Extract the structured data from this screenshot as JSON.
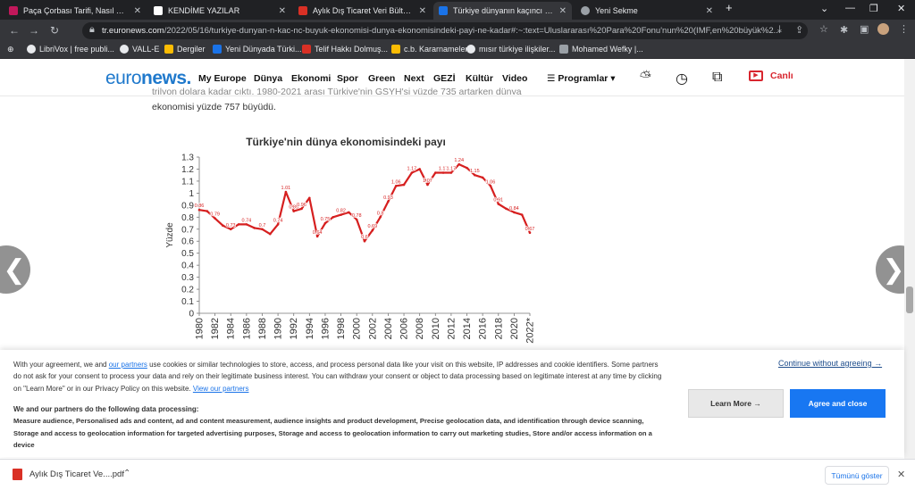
{
  "browser": {
    "tabs": [
      {
        "title": "Paça Çorbası Tarifi, Nasıl Yapılır?",
        "color": "#c2185b",
        "active": false
      },
      {
        "title": "KENDİME YAZILAR",
        "color": "#ffffff",
        "active": false
      },
      {
        "title": "Aylık Dış Ticaret Veri Bülteni_May",
        "color": "#d93025",
        "active": false
      },
      {
        "title": "Türkiye dünyanın kaçıncı büyük ekonomisi",
        "color": "#1a73e8",
        "active": true
      },
      {
        "title": "Yeni Sekme",
        "color": "#9aa0a6",
        "active": false
      }
    ],
    "new_tab": "+",
    "window_controls": {
      "chevron": "⌄",
      "minimize": "—",
      "maximize": "❐",
      "close": "✕"
    },
    "nav": {
      "back": "←",
      "forward": "→",
      "reload": "↻"
    },
    "url_host": "tr.euronews.com",
    "url_path": "/2022/05/16/turkiye-dunyan-n-kac-nc-buyuk-ekonomisi-dunya-ekonomisindeki-payi-ne-kadar#:~:text=Uluslararası%20Para%20Fonu'nun%20(IMF,en%20büyük%2..."
  },
  "bookmarks": [
    {
      "label": "LibriVox | free publi...",
      "color": "#e8eaed"
    },
    {
      "label": "VALL-E",
      "color": "#e8eaed"
    },
    {
      "label": "Dergiler",
      "color": "#fbbc04"
    },
    {
      "label": "Yeni Dünyada Türki...",
      "color": "#1a73e8"
    },
    {
      "label": "Telif Hakkı Dolmuş...",
      "color": "#d93025"
    },
    {
      "label": "c.b. Kararnameler",
      "color": "#fbbc04"
    },
    {
      "label": "mısır türkiye ilişkiler...",
      "color": "#e8eaed"
    },
    {
      "label": "Mohamed Wefky |...",
      "color": "#9aa0a6"
    }
  ],
  "site": {
    "logo_prefix": "euro",
    "logo_suffix": "news.",
    "nav_links": [
      "My Europe",
      "Dünya",
      "Ekonomi",
      "Spor",
      "Green",
      "Next",
      "GEZİ",
      "Kültür",
      "Video"
    ],
    "programs_label": "Programlar",
    "live_label": "Canlı",
    "accent_color": "#1f79cc",
    "live_color": "#d8262f"
  },
  "article": {
    "line1": "trilyon dolara kadar çıktı. 1980-2021 arası Türkiye'nin GSYH'si yüzde 735 artarken dünya",
    "line2": "ekonomisi yüzde 757 büyüdü."
  },
  "chart_data": {
    "type": "line",
    "title": "Türkiye'nin dünya ekonomisindeki payı",
    "ylabel": "Yüzde",
    "xlabel": "",
    "ylim": [
      0,
      1.3
    ],
    "yticks": [
      0,
      0.1,
      0.2,
      0.3,
      0.4,
      0.5,
      0.6,
      0.7,
      0.8,
      0.9,
      1,
      1.1,
      1.2,
      1.3
    ],
    "xtick_labels": [
      "1980",
      "1982",
      "1984",
      "1986",
      "1988",
      "1990",
      "1992",
      "1994",
      "1996",
      "1998",
      "2000",
      "2002",
      "2004",
      "2006",
      "2008",
      "2010",
      "2012",
      "2014",
      "2016",
      "2018",
      "2020",
      "2022*"
    ],
    "color": "#d61f1f",
    "x": [
      1980,
      1981,
      1982,
      1983,
      1984,
      1985,
      1986,
      1987,
      1988,
      1989,
      1990,
      1991,
      1992,
      1993,
      1994,
      1995,
      1996,
      1997,
      1998,
      1999,
      2000,
      2001,
      2002,
      2003,
      2004,
      2005,
      2006,
      2007,
      2008,
      2009,
      2010,
      2011,
      2012,
      2013,
      2014,
      2015,
      2016,
      2017,
      2018,
      2019,
      2020,
      2021,
      2022
    ],
    "values": [
      0.86,
      0.85,
      0.79,
      0.73,
      0.7,
      0.74,
      0.74,
      0.71,
      0.7,
      0.66,
      0.74,
      1.01,
      0.85,
      0.87,
      0.96,
      0.64,
      0.75,
      0.8,
      0.82,
      0.84,
      0.78,
      0.6,
      0.69,
      0.8,
      0.93,
      1.06,
      1.07,
      1.17,
      1.2,
      1.07,
      1.17,
      1.17,
      1.17,
      1.24,
      1.21,
      1.15,
      1.13,
      1.06,
      0.91,
      0.87,
      0.84,
      0.82,
      0.67
    ],
    "data_labels": [
      {
        "x": 1980,
        "label": "0.86"
      },
      {
        "x": 1982,
        "label": "0.79"
      },
      {
        "x": 1984,
        "label": "0.73"
      },
      {
        "x": 1986,
        "label": "0.74"
      },
      {
        "x": 1988,
        "label": "0.7"
      },
      {
        "x": 1990,
        "label": "0.74"
      },
      {
        "x": 1991,
        "label": "1.01"
      },
      {
        "x": 1992,
        "label": "0.85"
      },
      {
        "x": 1993,
        "label": "0.96"
      },
      {
        "x": 1995,
        "label": "0.64"
      },
      {
        "x": 1996,
        "label": "0.75"
      },
      {
        "x": 1998,
        "label": "0.82"
      },
      {
        "x": 2000,
        "label": "0.78"
      },
      {
        "x": 2001,
        "label": "0.6"
      },
      {
        "x": 2002,
        "label": "0.69"
      },
      {
        "x": 2003,
        "label": "0.8"
      },
      {
        "x": 2004,
        "label": "0.93"
      },
      {
        "x": 2005,
        "label": "1.06"
      },
      {
        "x": 2007,
        "label": "1.17"
      },
      {
        "x": 2009,
        "label": "1.07"
      },
      {
        "x": 2011,
        "label": "1.17"
      },
      {
        "x": 2012,
        "label": "1.17"
      },
      {
        "x": 2013,
        "label": "1.24"
      },
      {
        "x": 2015,
        "label": "1.15"
      },
      {
        "x": 2017,
        "label": "1.06"
      },
      {
        "x": 2018,
        "label": "0.91"
      },
      {
        "x": 2020,
        "label": "0.84"
      },
      {
        "x": 2022,
        "label": "0.67"
      }
    ],
    "grid": false,
    "legend": "none"
  },
  "consent": {
    "p1_a": "With your agreement, we and ",
    "p1_link": "our partners",
    "p1_b": " use cookies or similar technologies to store, access, and process personal data like your visit on this website, IP addresses and cookie identifiers. Some partners do not ask for your consent to process your data and rely on their legitimate business interest. You can withdraw your consent or object to data processing based on legitimate interest at any time by clicking on \"Learn More\" or in our Privacy Policy on this website. ",
    "p1_link2": "View our partners",
    "purposes_heading": "We and our partners do the following data processing:",
    "purposes": "Measure audience, Personalised ads and content, ad and content measurement, audience insights and product development, Precise geolocation data, and identification through device scanning, Storage and access to geolocation information for targeted advertising purposes, Storage and access to geolocation information to carry out marketing studies, Store and/or access information on a device",
    "continue_label": "Continue without agreeing →",
    "learn_more_label": "Learn More →",
    "agree_label": "Agree and close",
    "agree_color": "#1877f2"
  },
  "downloads": {
    "file": "Aylık Dış Ticaret Ve....pdf",
    "chevron": "⌃",
    "show_all": "Tümünü göster",
    "close": "✕"
  }
}
